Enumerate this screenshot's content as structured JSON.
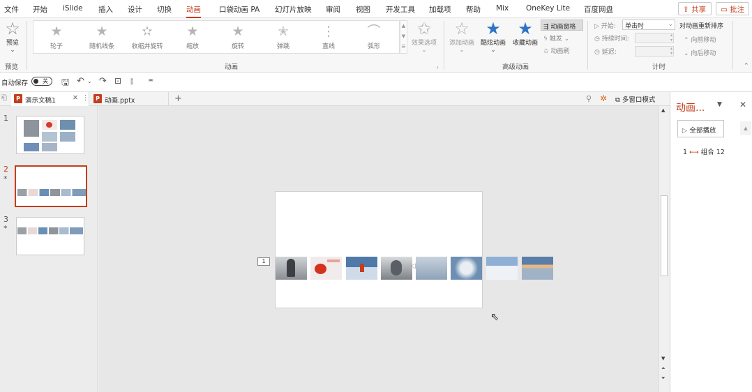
{
  "menu": {
    "items": [
      "文件",
      "开始",
      "iSlide",
      "插入",
      "设计",
      "切换",
      "动画",
      "口袋动画 PA",
      "幻灯片放映",
      "审阅",
      "视图",
      "开发工具",
      "加载项",
      "帮助",
      "Mix",
      "OneKey Lite",
      "百度网盘"
    ],
    "active": "动画",
    "share_label": "共享",
    "comment_label": "批注"
  },
  "ribbon": {
    "preview_label": "预览",
    "preview_group": "预览",
    "effects": [
      "轮子",
      "随机线条",
      "收缩并旋转",
      "缩放",
      "旋转",
      "弹跳",
      "直线",
      "弧形"
    ],
    "effect_options_label": "效果选项",
    "animation_group": "动画",
    "add_animation_label": "添加动画",
    "cool_animation_label": "酷炫动画",
    "collect_animation_label": "收藏动画",
    "animation_pane_label": "动画窗格",
    "trigger_label": "触发",
    "animation_painter_label": "动画刷",
    "advanced_group": "高级动画",
    "start_label": "开始:",
    "start_value": "单击时",
    "duration_label": "持续时间:",
    "delay_label": "延迟:",
    "timing_group": "计时",
    "reorder_label": "对动画重新排序",
    "move_earlier_label": "向前移动",
    "move_later_label": "向后移动"
  },
  "qat": {
    "autosave_label": "自动保存",
    "autosave_state": "关"
  },
  "tabs": {
    "doc1": "演示文稿1",
    "doc2": "动画.pptx",
    "add": "+",
    "multiwindow_label": "多窗口模式"
  },
  "thumbnails": [
    {
      "number": "1",
      "star": ""
    },
    {
      "number": "2",
      "star": "*"
    },
    {
      "number": "3",
      "star": "*"
    }
  ],
  "slide": {
    "animation_tag": "1"
  },
  "anim_pane": {
    "title": "动画...",
    "play_all_label": "全部播放",
    "item_number": "1",
    "item_label": "组合 12"
  },
  "colors": {
    "accent": "#c43e1c",
    "star_blue": "#2e74c4"
  }
}
